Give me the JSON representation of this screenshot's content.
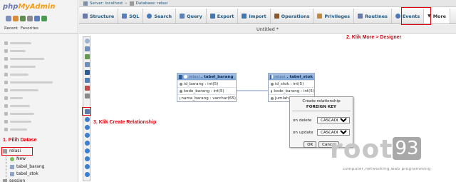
{
  "nav": {
    "logo_part1": "php",
    "logo_part2": "MyAdmin",
    "tabs": [
      "Recent",
      "Favorites"
    ],
    "tree": {
      "database": "relasi",
      "children": [
        "New",
        "tabel_barang",
        "tabel_stok"
      ],
      "next_database": "session"
    }
  },
  "topbar": {
    "server": "Server: localhost",
    "database": "Database: relasi"
  },
  "tabs": [
    {
      "label": "Structure",
      "icon": "structure-icon",
      "color": "#6b7ba5"
    },
    {
      "label": "SQL",
      "icon": "sql-icon",
      "color": "#5a7cc0"
    },
    {
      "label": "Search",
      "icon": "search-icon",
      "color": "#4a79b8"
    },
    {
      "label": "Query",
      "icon": "query-icon",
      "color": "#5f82b5"
    },
    {
      "label": "Export",
      "icon": "export-icon",
      "color": "#3f78b3"
    },
    {
      "label": "Import",
      "icon": "import-icon",
      "color": "#3f78b3"
    },
    {
      "label": "Operations",
      "icon": "wrench-icon",
      "color": "#8b5a2b"
    },
    {
      "label": "Privileges",
      "icon": "privileges-icon",
      "color": "#c08a3e"
    },
    {
      "label": "Routines",
      "icon": "routines-icon",
      "color": "#6b7ba5"
    },
    {
      "label": "Events",
      "icon": "clock-icon",
      "color": "#4a79b8"
    },
    {
      "label": "More",
      "icon": "chevron-down-icon",
      "color": "#333333"
    }
  ],
  "designer": {
    "title": "Untitled *",
    "tables": [
      {
        "db": "relasi",
        "name": "tabel_barang",
        "columns": [
          "id_barang : int(5)",
          "kode_barang : int(5)",
          "nama_barang : varchar(65)"
        ]
      },
      {
        "db": "relasi",
        "name": "tabel_stok",
        "columns": [
          "id_stok : int(5)",
          "kode_barang : int(5)",
          "jumlah"
        ]
      }
    ],
    "dialog": {
      "title": "Create relationship",
      "subtitle": "FOREIGN KEY",
      "on_delete_label": "on delete",
      "on_delete_value": "CASCADE",
      "on_update_label": "on update",
      "on_update_value": "CASCADE",
      "ok_label": "OK",
      "cancel_label": "Cancel"
    }
  },
  "annotations": {
    "step1": "1. Pilih Datase",
    "step2": "2. Klik More > Designer",
    "step3": "3. Klik Create Relationship"
  },
  "watermark": {
    "brand": "root",
    "number": "93",
    "tagline": "computer,networking,web programming"
  },
  "colors": {
    "annotation_red": "#e3000f",
    "link_blue": "#235a81",
    "table_header": "#7ea4d4"
  }
}
